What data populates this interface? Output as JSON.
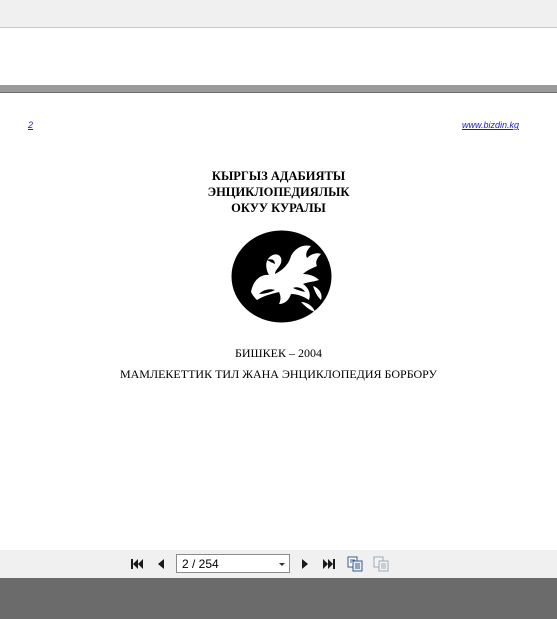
{
  "document": {
    "page_number": "2",
    "site_link": "www.bizdin.kg",
    "title_lines": [
      "КЫРГЫЗ АДАБИЯТЫ",
      "ЭНЦИКЛОПЕДИЯЛЫК",
      "ОКУУ КУРАЛЫ"
    ],
    "city_year": "БИШКЕК – 2004",
    "publisher": "МАМЛЕКЕТТИК ТИЛ ЖАНА ЭНЦИКЛОПЕДИЯ БОРБОРУ"
  },
  "toolbar": {
    "page_indicator": "2 / 254",
    "buttons": [
      "first-page-icon",
      "prev-page-icon",
      "next-page-icon",
      "last-page-icon",
      "fit-page-icon",
      "fit-width-icon"
    ]
  },
  "colors": {
    "toolbar_bg": "#f0f0f0",
    "viewer_bg": "#6b6b6b",
    "link": "#1a1acc"
  }
}
